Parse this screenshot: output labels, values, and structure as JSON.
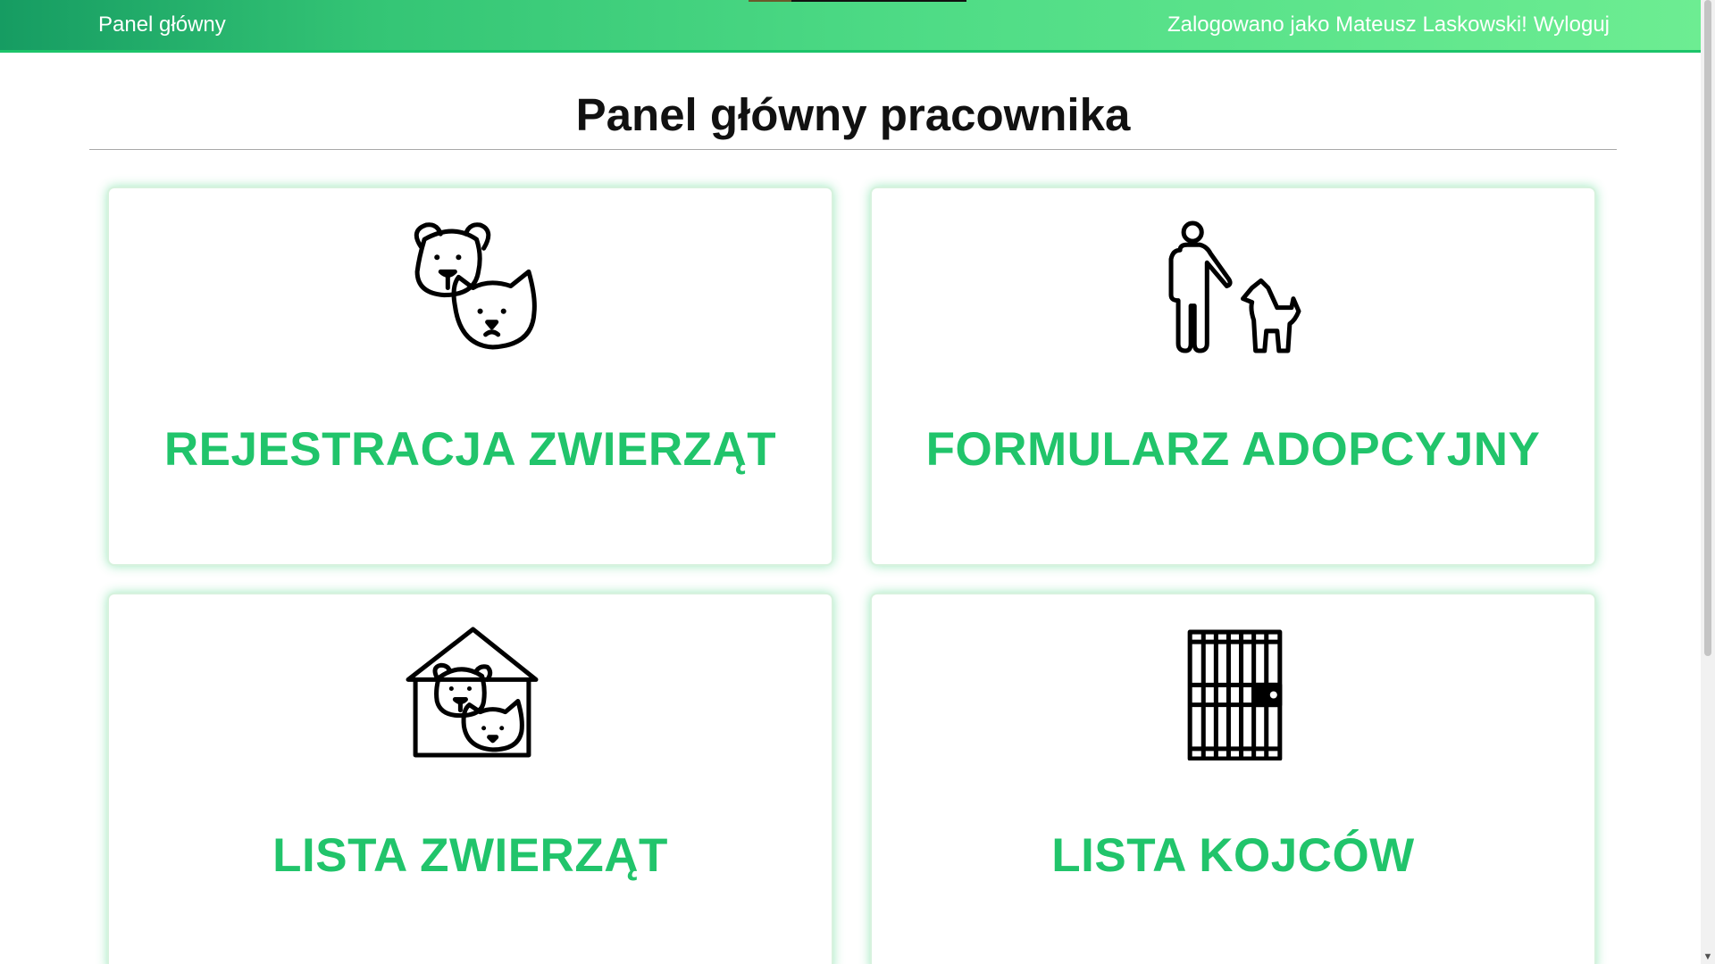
{
  "navbar": {
    "home_label": "Panel główny",
    "logged_in_text": "Zalogowano jako Mateusz Laskowski!",
    "logout_label": "Wyloguj"
  },
  "page": {
    "title": "Panel główny pracownika"
  },
  "cards": [
    {
      "label": "REJESTRACJA ZWIERZĄT",
      "icon": "dog-cat-icon"
    },
    {
      "label": "FORMULARZ ADOPCYJNY",
      "icon": "person-walking-dog-icon"
    },
    {
      "label": "LISTA ZWIERZĄT",
      "icon": "pet-house-icon"
    },
    {
      "label": "LISTA KOJCÓW",
      "icon": "kennel-cage-icon"
    }
  ],
  "colors": {
    "navbar_gradient_start": "#169c62",
    "navbar_gradient_end": "#6ded92",
    "accent_green": "#21c46b",
    "title_text": "#111111"
  },
  "scrollbar": {
    "down_arrow_icon": "chevron-down-icon"
  }
}
